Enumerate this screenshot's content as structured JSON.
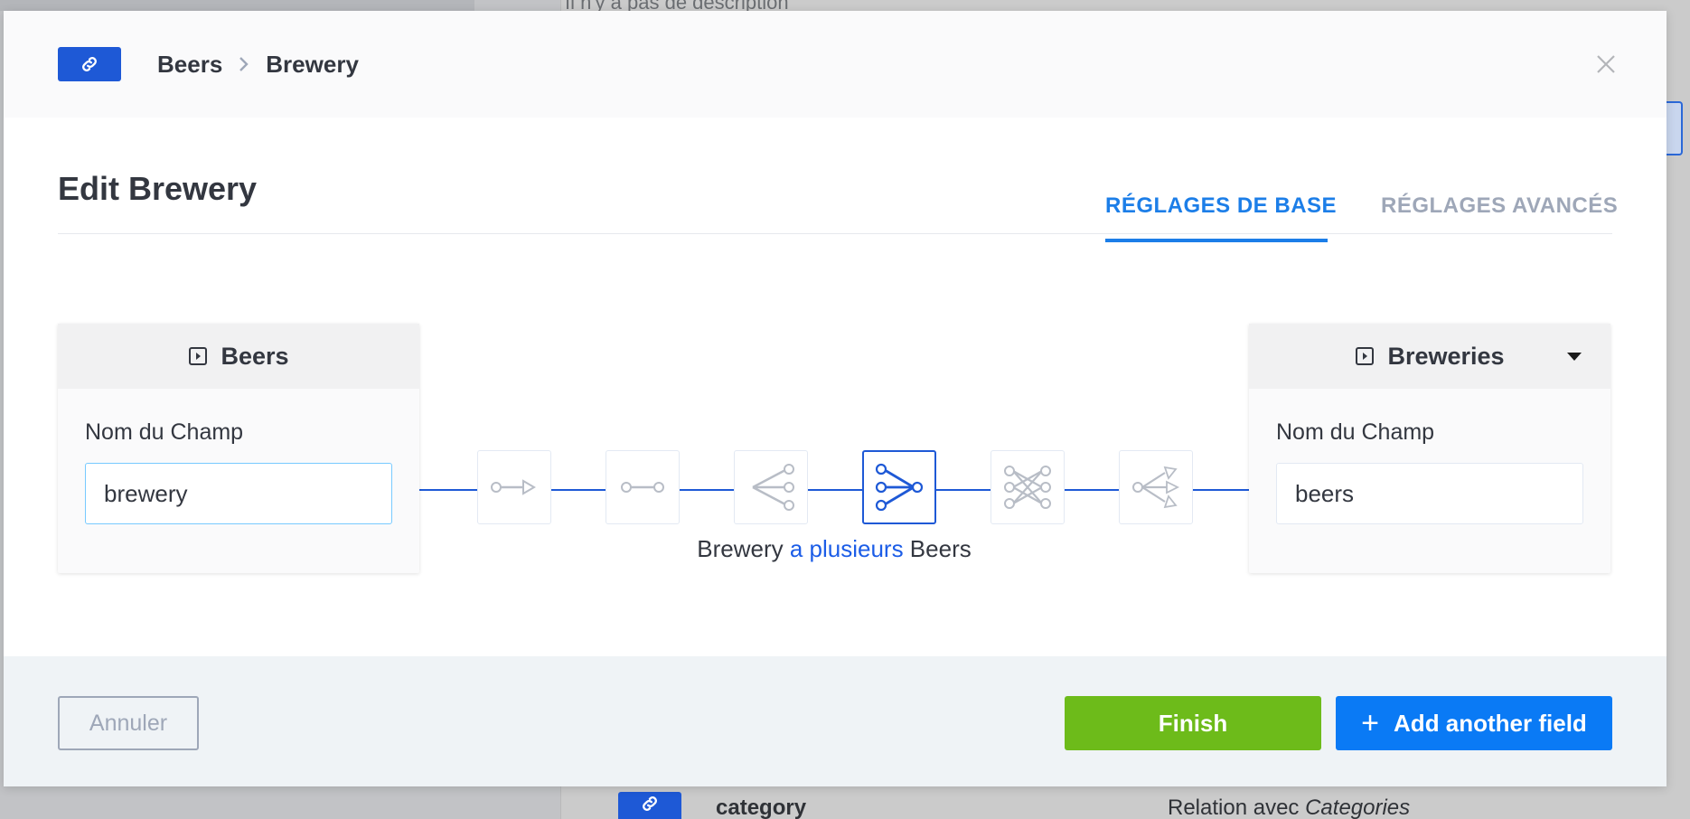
{
  "background": {
    "description_text": "Il n'y a pas de description",
    "row": {
      "name": "category",
      "relation_prefix": "Relation avec ",
      "relation_target": "Categories"
    }
  },
  "header": {
    "breadcrumb": [
      "Beers",
      "Brewery"
    ]
  },
  "title": "Edit Brewery",
  "tabs": {
    "base": "RÉGLAGES DE BASE",
    "advanced": "RÉGLAGES AVANCÉS"
  },
  "left_box": {
    "model": "Beers",
    "label": "Nom du Champ",
    "value": "brewery"
  },
  "right_box": {
    "model": "Breweries",
    "label": "Nom du Champ",
    "value": "beers"
  },
  "relation_text": {
    "prefix": "Brewery ",
    "highlight": "a plusieurs",
    "suffix": " Beers"
  },
  "footer": {
    "cancel": "Annuler",
    "finish": "Finish",
    "add": "Add another field",
    "add_icon": "+"
  },
  "colors": {
    "primary": "#1e59d6",
    "tab_active": "#1c7ee8",
    "finish": "#6dbb1a",
    "add": "#0a7af5"
  }
}
